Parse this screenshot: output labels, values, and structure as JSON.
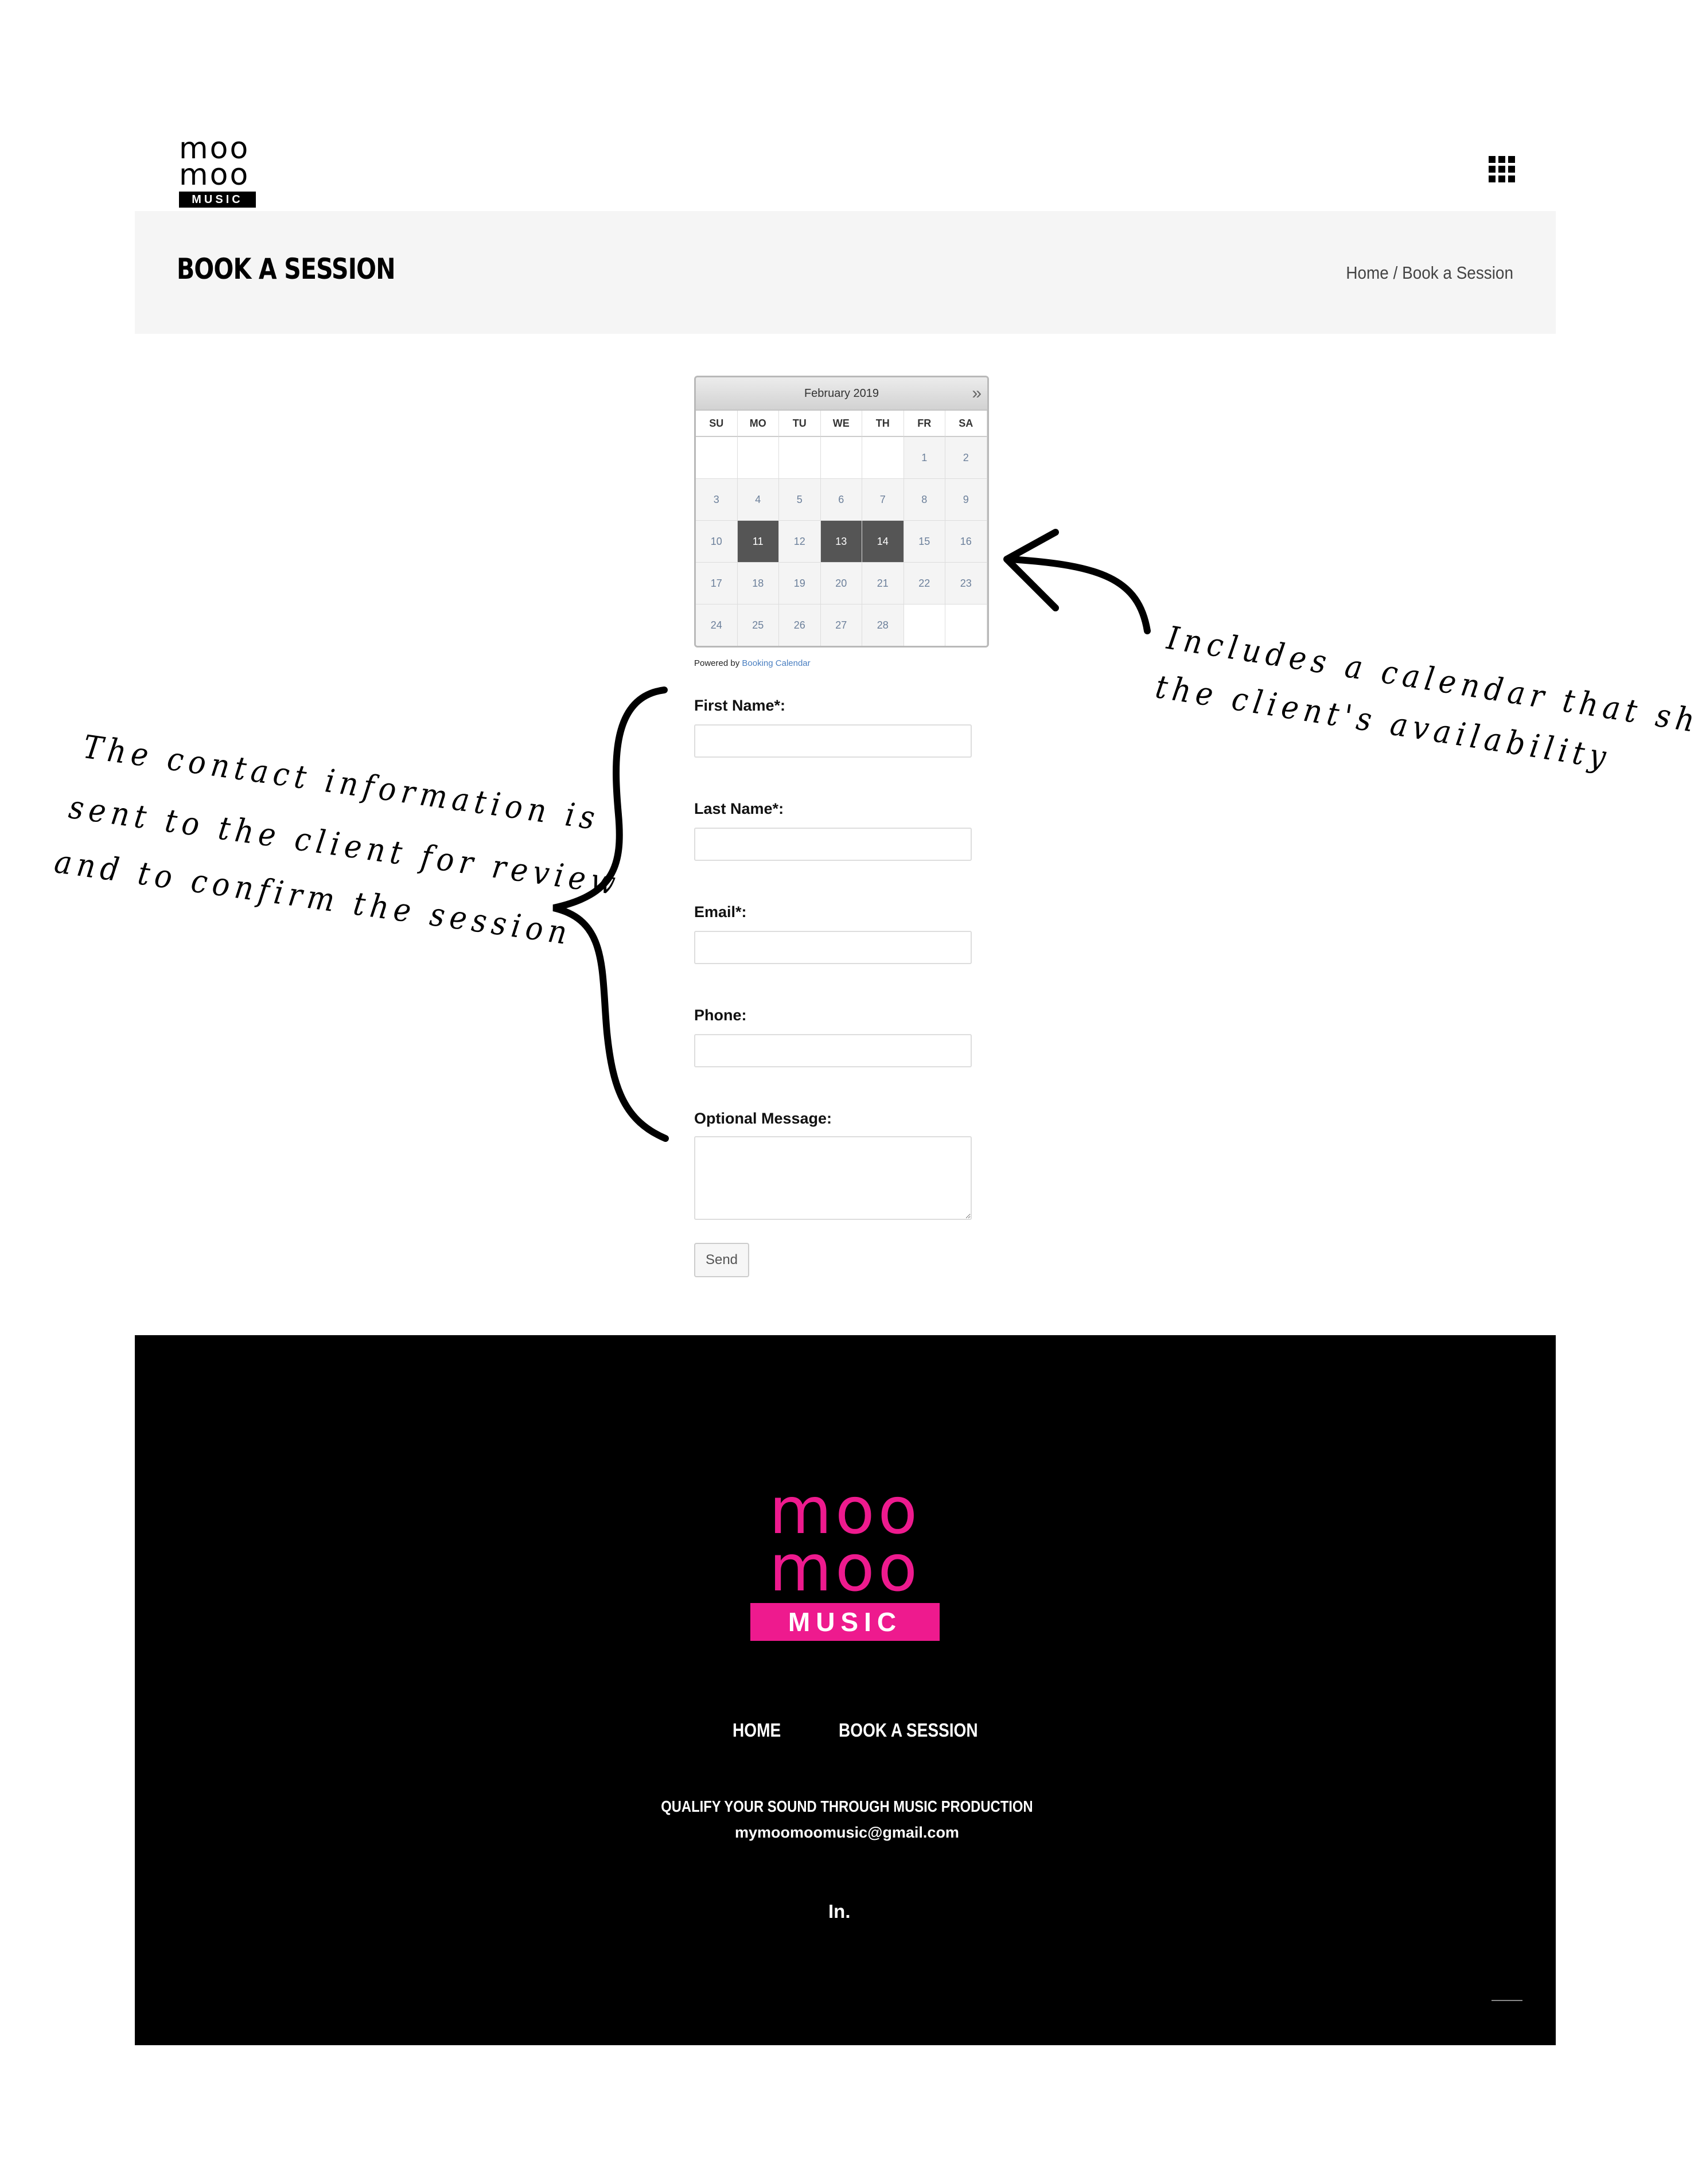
{
  "header": {
    "logo_line1": "moo",
    "logo_line2": "moo",
    "logo_badge": "MUSIC",
    "menu_icon": "grid-menu-icon"
  },
  "title_bar": {
    "title": "BOOK A SESSION",
    "breadcrumb_home": "Home",
    "breadcrumb_sep": " / ",
    "breadcrumb_current": "Book a Session"
  },
  "calendar": {
    "month": "February 2019",
    "next_icon": "»",
    "days_of_week": [
      "SU",
      "MO",
      "TU",
      "WE",
      "TH",
      "FR",
      "SA"
    ],
    "cells": [
      "",
      "",
      "",
      "",
      "",
      "1",
      "2",
      "3",
      "4",
      "5",
      "6",
      "7",
      "8",
      "9",
      "10",
      "11",
      "12",
      "13",
      "14",
      "15",
      "16",
      "17",
      "18",
      "19",
      "20",
      "21",
      "22",
      "23",
      "24",
      "25",
      "26",
      "27",
      "28",
      "",
      ""
    ],
    "booked_days": [
      "11",
      "13",
      "14"
    ],
    "powered_by": "Powered by",
    "powered_link": "Booking Calendar"
  },
  "form": {
    "first_name_label": "First Name*:",
    "first_name_value": "",
    "last_name_label": "Last Name*:",
    "last_name_value": "",
    "email_label": "Email*:",
    "email_value": "",
    "phone_label": "Phone:",
    "phone_value": "",
    "message_label": "Optional Message:",
    "message_value": "",
    "send_label": "Send"
  },
  "annotations": {
    "left_line1": "The contact information is",
    "left_line2": "sent to the client for review",
    "left_line3": "and to confirm the session",
    "right_line1": "Includes a calendar that shows",
    "right_line2": "the client's availability"
  },
  "footer": {
    "logo_line1": "moo",
    "logo_line2": "moo",
    "logo_badge": "MUSIC",
    "nav_home": "HOME",
    "nav_book": "BOOK A SESSION",
    "tagline": "QUALIFY YOUR SOUND THROUGH MUSIC PRODUCTION",
    "email": "mymoomoomusic@gmail.com",
    "social": "In.",
    "brand_color": "#ee1a8e"
  },
  "colors": {
    "booked_day": "#555555",
    "title_bar_bg": "#f5f5f5",
    "footer_bg": "#000000"
  }
}
